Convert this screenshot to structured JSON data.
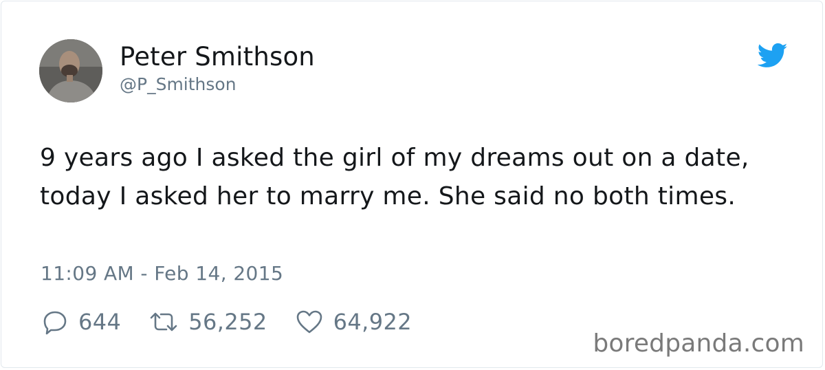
{
  "tweet": {
    "author": {
      "display_name": "Peter Smithson",
      "handle": "@P_Smithson",
      "avatar": "profile-photo"
    },
    "text": "9 years ago I asked the girl of my dreams out on a date, today I asked her to marry me. She said no both times.",
    "timestamp": "11:09 AM - Feb 14, 2015",
    "stats": {
      "replies": "644",
      "retweets": "56,252",
      "likes": "64,922"
    },
    "icons": {
      "brand": "twitter-bird-icon",
      "reply": "speech-bubble-icon",
      "retweet": "retweet-arrows-icon",
      "like": "heart-icon"
    }
  },
  "watermark": "boredpanda.com",
  "colors": {
    "text": "#14171a",
    "secondary": "#657786",
    "brand": "#1da1f2",
    "border": "#e1e8ed"
  }
}
